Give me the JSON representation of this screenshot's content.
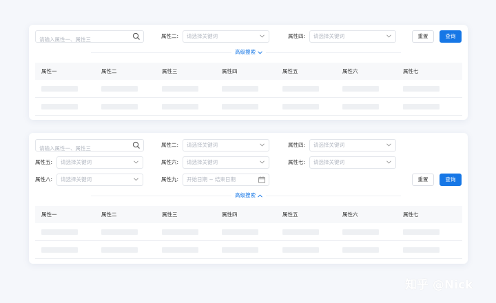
{
  "colors": {
    "primary": "#1677e6",
    "placeholder": "#b3b8c2",
    "border": "#e2e5ea"
  },
  "card1": {
    "search_placeholder": "请输入属性一、属性三",
    "filters": [
      {
        "label": "属性二:",
        "placeholder": "请选择关键词"
      },
      {
        "label": "属性四:",
        "placeholder": "请选择关键词"
      }
    ],
    "reset_label": "重置",
    "query_label": "查询",
    "advanced_label": "高级搜索",
    "table": {
      "columns": [
        "属性一",
        "属性二",
        "属性三",
        "属性四",
        "属性五",
        "属性六",
        "属性七"
      ]
    }
  },
  "card2": {
    "search_placeholder": "请输入属性一、属性三",
    "filters": [
      {
        "label": "属性二:",
        "placeholder": "请选择关键词"
      },
      {
        "label": "属性四:",
        "placeholder": "请选择关键词"
      },
      {
        "label": "属性五:",
        "placeholder": "请选择关键词"
      },
      {
        "label": "属性六:",
        "placeholder": "请选择关键词"
      },
      {
        "label": "属性七:",
        "placeholder": "请选择关键词"
      },
      {
        "label": "属性八:",
        "placeholder": "请选择关键词"
      },
      {
        "label": "属性九:",
        "placeholder": "开始日期 ~ 结束日期"
      }
    ],
    "reset_label": "重置",
    "query_label": "查询",
    "advanced_label": "高级搜索",
    "table": {
      "columns": [
        "属性一",
        "属性二",
        "属性三",
        "属性四",
        "属性五",
        "属性六",
        "属性七"
      ]
    }
  },
  "watermark": "知乎 @Nick"
}
